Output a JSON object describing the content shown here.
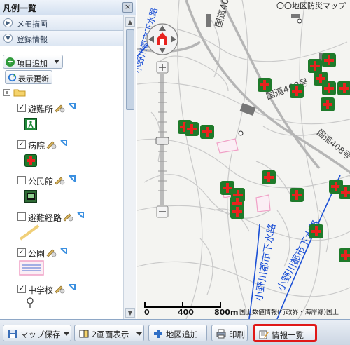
{
  "legend": {
    "title": "凡例一覧",
    "close_label": "×",
    "sections": [
      {
        "label": "メモ描画"
      },
      {
        "label": "登録情報"
      }
    ],
    "add_item_label": "項目追加",
    "refresh_label": "表示更新",
    "layers": [
      {
        "name": "避難所",
        "checked": true,
        "check_mark": "✓"
      },
      {
        "name": "病院",
        "checked": true,
        "check_mark": "✓"
      },
      {
        "name": "公民館",
        "checked": false,
        "check_mark": ""
      },
      {
        "name": "避難経路",
        "checked": false,
        "check_mark": ""
      },
      {
        "name": "公園",
        "checked": true,
        "check_mark": "✓"
      },
      {
        "name": "中学校",
        "checked": true,
        "check_mark": "✓"
      }
    ]
  },
  "map": {
    "title": "〇〇地区防災マップ",
    "scale_labels": [
      "0",
      "400",
      "800m"
    ],
    "attribution": "国土数値情報(行政界・海岸線)国土",
    "road_labels": [
      "小野川都市下水路",
      "小野川都市下水路",
      "国道408号",
      "国道408号",
      "国道408号",
      "小野川都市下水路"
    ],
    "hospital_marker_count": 21,
    "colors": {
      "hospital_red": "#e8231f",
      "marker_green": "#1f7a2a",
      "river_blue": "#1a4fd6"
    }
  },
  "toolbar": {
    "buttons": [
      {
        "label": "マップ保存"
      },
      {
        "label": "2画面表示"
      },
      {
        "label": "地図追加"
      },
      {
        "label": "印刷"
      },
      {
        "label": "情報一覧"
      }
    ],
    "highlight_color": "#e01818"
  }
}
